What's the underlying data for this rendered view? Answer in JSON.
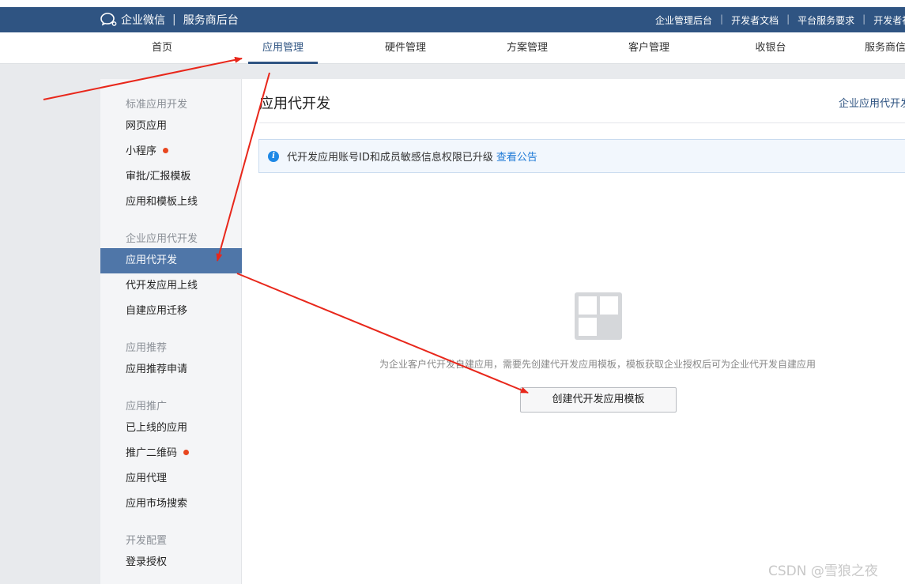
{
  "topbar": {
    "brand": "企业微信",
    "separator": "|",
    "subtitle": "服务商后台",
    "links": [
      "企业管理后台",
      "开发者文档",
      "平台服务要求",
      "开发者社区"
    ]
  },
  "nav": {
    "items": [
      "首页",
      "应用管理",
      "硬件管理",
      "方案管理",
      "客户管理",
      "收银台",
      "服务商信息"
    ],
    "active_index": 1
  },
  "sidebar": {
    "groups": [
      {
        "title": "标准应用开发",
        "items": [
          "网页应用",
          "小程序",
          "审批/汇报模板",
          "应用和模板上线"
        ]
      },
      {
        "title": "企业应用代开发",
        "items": [
          "应用代开发",
          "代开发应用上线",
          "自建应用迁移"
        ]
      },
      {
        "title": "应用推荐",
        "items": [
          "应用推荐申请"
        ]
      },
      {
        "title": "应用推广",
        "items": [
          "已上线的应用",
          "推广二维码",
          "应用代理",
          "应用市场搜索"
        ]
      },
      {
        "title": "开发配置",
        "items": [
          "登录授权"
        ]
      }
    ],
    "active_item": "应用代开发",
    "badge_items": [
      "小程序",
      "推广二维码"
    ]
  },
  "main": {
    "title": "应用代开发",
    "title_link": "企业应用代开发指引",
    "notice_text": "代开发应用账号ID和成员敏感信息权限已升级",
    "notice_link": "查看公告",
    "empty_text": "为企业客户代开发自建应用，需要先创建代开发应用模板，模板获取企业授权后可为企业代开发自建应用",
    "create_button": "创建代开发应用模板"
  },
  "watermark": "CSDN @雪狼之夜",
  "colors": {
    "topbar": "#2f5482",
    "active_sidebar": "#4f76a8",
    "badge": "#e8461f",
    "annotation_arrow": "#e8271b",
    "link": "#1e7ad6"
  }
}
